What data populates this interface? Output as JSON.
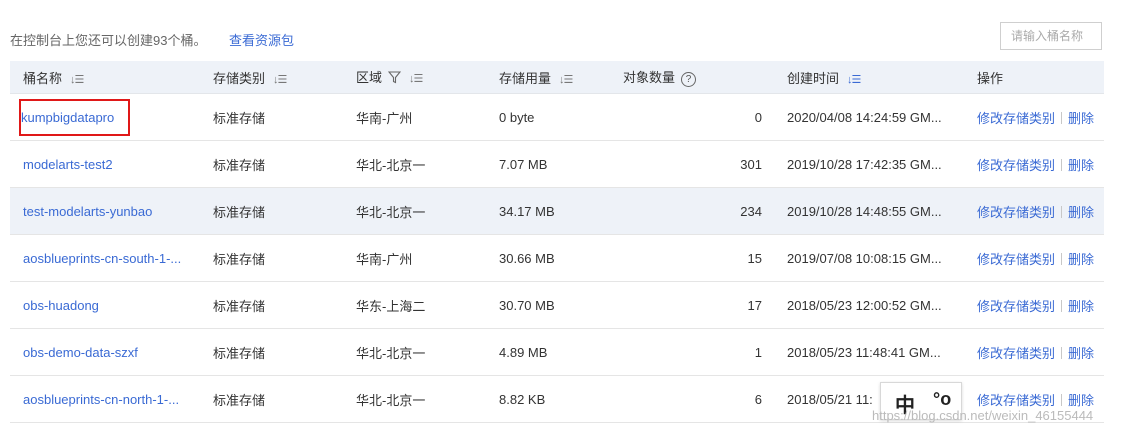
{
  "toolbar": {
    "quota_text": "在控制台上您还可以创建93个桶。",
    "quota_link": "查看资源包",
    "search_placeholder": "请输入桶名称"
  },
  "table": {
    "headers": {
      "name": "桶名称",
      "storage_class": "存储类别",
      "region": "区域",
      "usage": "存储用量",
      "objects": "对象数量",
      "created": "创建时间",
      "ops": "操作"
    },
    "rows": [
      {
        "name": "kumpbigdatapro",
        "storage_class": "标准存储",
        "region": "华南-广州",
        "usage": "0 byte",
        "objects": "0",
        "created": "2020/04/08 14:24:59 GM...",
        "op_modify": "修改存储类别",
        "op_delete": "删除"
      },
      {
        "name": "modelarts-test2",
        "storage_class": "标准存储",
        "region": "华北-北京一",
        "usage": "7.07 MB",
        "objects": "301",
        "created": "2019/10/28 17:42:35 GM...",
        "op_modify": "修改存储类别",
        "op_delete": "删除"
      },
      {
        "name": "test-modelarts-yunbao",
        "storage_class": "标准存储",
        "region": "华北-北京一",
        "usage": "34.17 MB",
        "objects": "234",
        "created": "2019/10/28 14:48:55 GM...",
        "op_modify": "修改存储类别",
        "op_delete": "删除"
      },
      {
        "name": "aosblueprints-cn-south-1-...",
        "storage_class": "标准存储",
        "region": "华南-广州",
        "usage": "30.66 MB",
        "objects": "15",
        "created": "2019/07/08 10:08:15 GM...",
        "op_modify": "修改存储类别",
        "op_delete": "删除"
      },
      {
        "name": "obs-huadong",
        "storage_class": "标准存储",
        "region": "华东-上海二",
        "usage": "30.70 MB",
        "objects": "17",
        "created": "2018/05/23 12:00:52 GM...",
        "op_modify": "修改存储类别",
        "op_delete": "删除"
      },
      {
        "name": "obs-demo-data-szxf",
        "storage_class": "标准存储",
        "region": "华北-北京一",
        "usage": "4.89 MB",
        "objects": "1",
        "created": "2018/05/23 11:48:41 GM...",
        "op_modify": "修改存储类别",
        "op_delete": "删除"
      },
      {
        "name": "aosblueprints-cn-north-1-...",
        "storage_class": "标准存储",
        "region": "华北-北京一",
        "usage": "8.82 KB",
        "objects": "6",
        "created": "2018/05/21 11:",
        "op_modify": "修改存储类别",
        "op_delete": "删除"
      }
    ]
  },
  "ime": {
    "lang": "中",
    "punct": "°o"
  },
  "watermark": "https://blog.csdn.net/weixin_46155444",
  "colors": {
    "link": "#3a6ad4",
    "header_bg": "#eef2f8",
    "highlight": "#e01818"
  },
  "icons": [
    "sort-icon",
    "filter-icon",
    "help-icon"
  ]
}
